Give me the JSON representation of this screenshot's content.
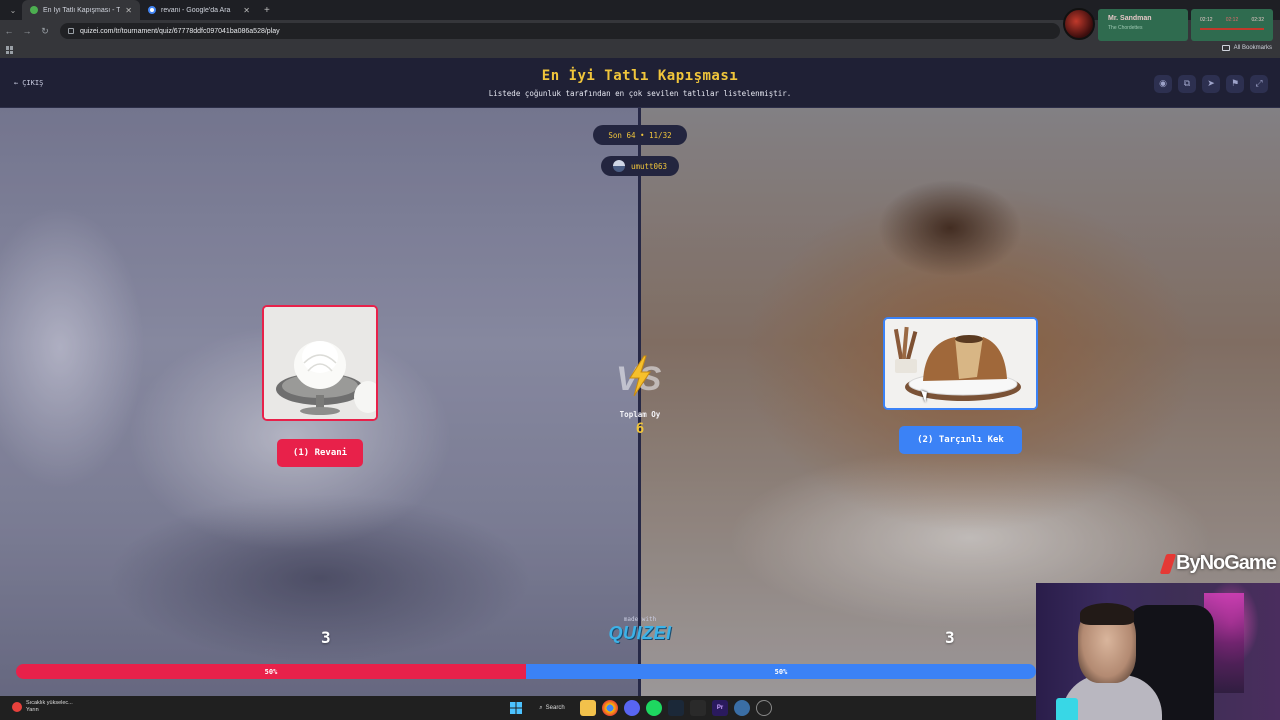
{
  "browser": {
    "tabs": [
      {
        "label": "En İyi Tatlı Kapışması - Tier List",
        "active": true
      },
      {
        "label": "revani - Google'da Ara",
        "active": false
      }
    ],
    "url": "quizei.com/tr/tournament/quiz/67778ddfc097041ba086a528/play",
    "bookmarks_all": "All Bookmarks"
  },
  "now_playing": {
    "title": "Mr. Sandman",
    "artist": "The Chordettes",
    "time_elapsed": "02:12",
    "time_mid": "02:12",
    "time_total": "02:32"
  },
  "header": {
    "exit_label": "ÇIKIŞ",
    "title": "En İyi Tatlı Kapışması",
    "subtitle": "Listede çoğunluk tarafından en çok sevilen tatlılar listelenmiştir.",
    "icons": [
      "eye-icon",
      "share-icon",
      "send-icon",
      "flag-icon",
      "fullscreen-icon"
    ]
  },
  "match": {
    "round": "Son 64 • 11/32",
    "username": "umutt063",
    "total_label": "Toplam Oy",
    "total_votes": "6",
    "left": {
      "label": "(1) Revani",
      "votes": "3",
      "percent": 50,
      "percent_label": "50%"
    },
    "right": {
      "label": "(2) Tarçınlı Kek",
      "votes": "3",
      "percent": 50,
      "percent_label": "50%"
    },
    "made_with": "made with",
    "logo": "QUIZEI"
  },
  "watermark": "ByNoGame",
  "taskbar": {
    "weather_line1": "Sıcaklık yükselec...",
    "weather_line2": "Yarın",
    "search_label": "Search"
  },
  "colors": {
    "accent_yellow": "#f0c53b",
    "left_red": "#e8214a",
    "right_blue": "#3b82f6",
    "header_bg": "#1f2035"
  }
}
